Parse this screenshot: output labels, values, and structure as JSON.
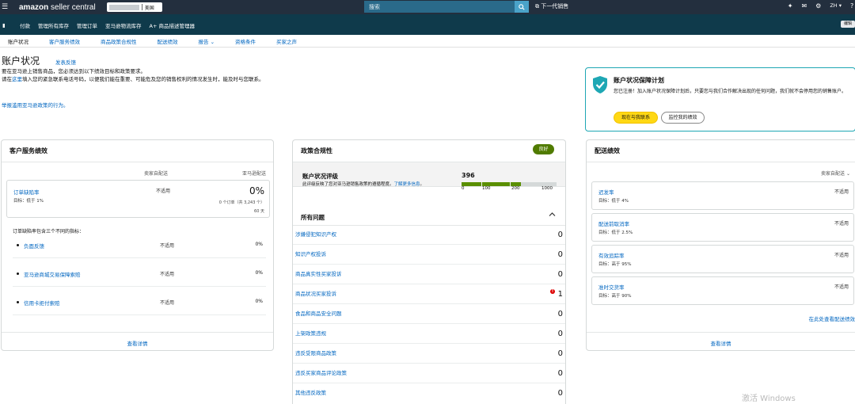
{
  "topbar": {
    "logo_bold": "amazon",
    "logo_rest": " seller central",
    "marketplace": "美国",
    "search_placeholder": "搜索",
    "next_gen": "下一代销售",
    "lang": "ZH"
  },
  "nav": {
    "items": [
      "付款",
      "管理所有库存",
      "管理订单",
      "亚马逊物流库存",
      "A+ 商品描述管理器"
    ],
    "edit": "编辑"
  },
  "tabs": [
    "账户状况",
    "客户服务绩效",
    "商品政策合规性",
    "配送绩效",
    "报告",
    "资格条件",
    "买家之声"
  ],
  "header": {
    "title": "账户状况",
    "feedback": "发表反馈",
    "intro_1": "要在亚马逊上销售商品，您必须达到以下绩效目标和政策要求。",
    "intro_2a": "请在",
    "intro_2b": "这里",
    "intro_2c": "填入您的紧急联系电话号码，以便我们能在重要、可能危及您的销售权利的情况发生时，能及时与您联系。",
    "abuse_link": "举报滥用亚马逊政策的行为。"
  },
  "protection": {
    "title": "账户状况保障计划",
    "desc": "您已注册！加入账户状况保障计划后，只要您与我们合作解决出现的任何问题，我们就不会停用您的销售账户。",
    "contact_btn": "现在与我联系",
    "monitor_btn": "监控我的绩效"
  },
  "customer_service": {
    "title": "客户服务绩效",
    "col_seller": "卖家自配送",
    "col_fba": "亚马逊配送",
    "odr": {
      "name": "订单缺陷率",
      "target": "目标：低于 1%",
      "seller": "不适用",
      "fba": "0%",
      "orders": "0 个订单（共 3,243 个）",
      "days": "60 天"
    },
    "sub_intro": "订单缺陷率包含三个不同的指标：",
    "metrics": [
      {
        "name": "负面反馈",
        "seller": "不适用",
        "fba": "0%"
      },
      {
        "name": "亚马逊商城交易保障索赔",
        "seller": "不适用",
        "fba": "0%"
      },
      {
        "name": "信用卡拒付索赔",
        "seller": "不适用",
        "fba": "0%"
      }
    ],
    "footer": "查看详情"
  },
  "policy": {
    "title": "政策合规性",
    "badge": "良好",
    "ahr_title": "账户状况评级",
    "ahr_desc_a": "此评级反映了您对亚马逊销售政策的遵循程度。",
    "ahr_desc_link": "了解更多信息",
    "ahr_desc_b": "。",
    "ahr_score": "396",
    "ahr_ticks": [
      "0",
      "100",
      "200",
      "1000"
    ],
    "issues_title": "所有问题",
    "issues": [
      {
        "name": "涉嫌侵犯知识产权",
        "count": "0",
        "alert": false
      },
      {
        "name": "知识产权投诉",
        "count": "0",
        "alert": false
      },
      {
        "name": "商品真实性买家投诉",
        "count": "0",
        "alert": false
      },
      {
        "name": "商品状况买家投诉",
        "count": "1",
        "alert": true
      },
      {
        "name": "食品和商品安全问题",
        "count": "0",
        "alert": false
      },
      {
        "name": "上架政策违规",
        "count": "0",
        "alert": false
      },
      {
        "name": "违反受限商品政策",
        "count": "0",
        "alert": false
      },
      {
        "name": "违反买家商品评论政策",
        "count": "0",
        "alert": false
      },
      {
        "name": "其他违反政策",
        "count": "0",
        "alert": false
      }
    ]
  },
  "shipping": {
    "title": "配送绩效",
    "col_seller": "卖家自配送",
    "metrics": [
      {
        "name": "迟发率",
        "target": "目标：低于 4%",
        "value": "不适用"
      },
      {
        "name": "配送前取消率",
        "target": "目标：低于 2.5%",
        "value": "不适用"
      },
      {
        "name": "有效追踪率",
        "target": "目标：高于 95%",
        "value": "不适用"
      },
      {
        "name": "准时交货率",
        "target": "目标：高于 90%",
        "value": "不适用"
      }
    ],
    "more_link": "在此处查看配送绩效",
    "footer": "查看详情"
  },
  "watermark": "激活 Windows",
  "colors": {
    "accent_teal": "#1ea7b4",
    "good_green": "#507b00",
    "bar_green": "#5a8f00",
    "topbar": "#232f3e",
    "nav": "#0f3a4b",
    "button_yellow": "#ffd814"
  }
}
